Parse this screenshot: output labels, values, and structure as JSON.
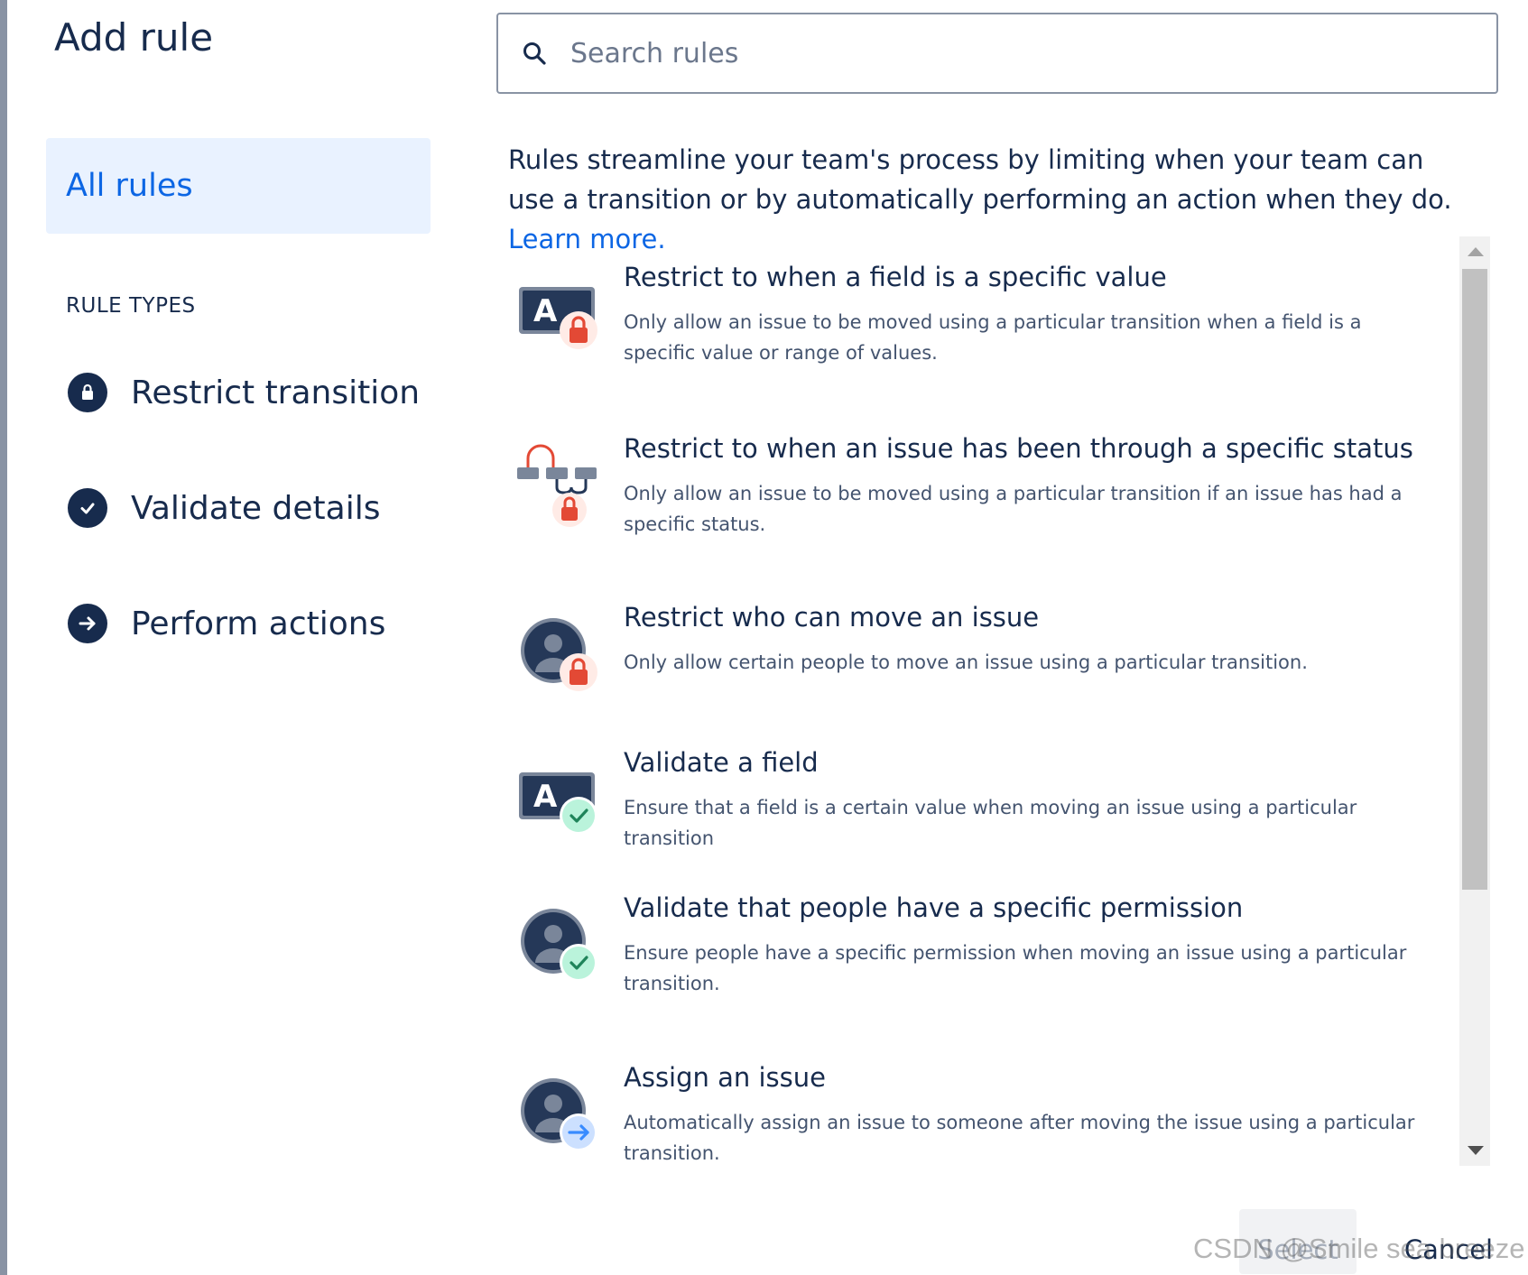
{
  "dialog": {
    "title": "Add rule"
  },
  "search": {
    "placeholder": "Search rules",
    "icon": "search-icon"
  },
  "sidebar": {
    "all_rules_label": "All rules",
    "rule_types_heading": "RULE TYPES",
    "types": [
      {
        "label": "Restrict transition",
        "icon": "lock-icon"
      },
      {
        "label": "Validate details",
        "icon": "check-icon"
      },
      {
        "label": "Perform actions",
        "icon": "arrow-right-icon"
      }
    ]
  },
  "intro": {
    "text": "Rules streamline your team's process by limiting when your team can use a transition or by automatically performing an action when they do.",
    "learn_more": "Learn more."
  },
  "rules": [
    {
      "title": "Restrict to when a field is a specific value",
      "description": "Only allow an issue to be moved using a particular transition when a field is a specific value or range of values.",
      "icon": "field-lock-icon"
    },
    {
      "title": "Restrict to when an issue has been through a specific status",
      "description": "Only allow an issue to be moved using a particular transition if an issue has had a specific status.",
      "icon": "status-lock-icon"
    },
    {
      "title": "Restrict who can move an issue",
      "description": "Only allow certain people to move an issue using a particular transition.",
      "icon": "user-lock-icon"
    },
    {
      "title": "Validate a field",
      "description": "Ensure that a field is a certain value when moving an issue using a particular transition",
      "icon": "field-check-icon"
    },
    {
      "title": "Validate that people have a specific permission",
      "description": "Ensure people have a specific permission when moving an issue using a particular transition.",
      "icon": "user-check-icon"
    },
    {
      "title": "Assign an issue",
      "description": "Automatically assign an issue to someone after moving the issue using a particular transition.",
      "icon": "user-arrow-icon"
    }
  ],
  "footer": {
    "select_label": "Select",
    "cancel_label": "Cancel"
  },
  "watermark": "CSDN @Smile sea breeze",
  "colors": {
    "text": "#172B4D",
    "accent": "#0C66E4",
    "selected_bg": "#E9F2FF",
    "lock_red": "#E34935",
    "check_green": "#1F845A",
    "arrow_blue": "#388BFF"
  }
}
